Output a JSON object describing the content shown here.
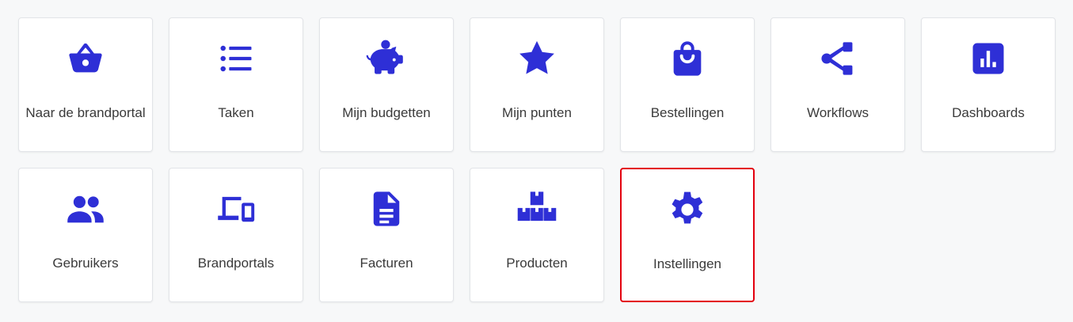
{
  "accent_color": "#2e2fd6",
  "highlight_color": "#e3000f",
  "tiles": [
    {
      "label": "Naar de brandportal",
      "icon": "shopping-basket-icon"
    },
    {
      "label": "Taken",
      "icon": "list-icon"
    },
    {
      "label": "Mijn budgetten",
      "icon": "piggy-bank-icon"
    },
    {
      "label": "Mijn punten",
      "icon": "star-icon"
    },
    {
      "label": "Bestellingen",
      "icon": "shopping-bag-icon"
    },
    {
      "label": "Workflows",
      "icon": "share-nodes-icon"
    },
    {
      "label": "Dashboards",
      "icon": "bar-chart-icon"
    },
    {
      "label": "Gebruikers",
      "icon": "users-icon"
    },
    {
      "label": "Brandportals",
      "icon": "devices-icon"
    },
    {
      "label": "Facturen",
      "icon": "document-icon"
    },
    {
      "label": "Producten",
      "icon": "boxes-icon"
    },
    {
      "label": "Instellingen",
      "icon": "gear-icon",
      "highlighted": true
    }
  ]
}
